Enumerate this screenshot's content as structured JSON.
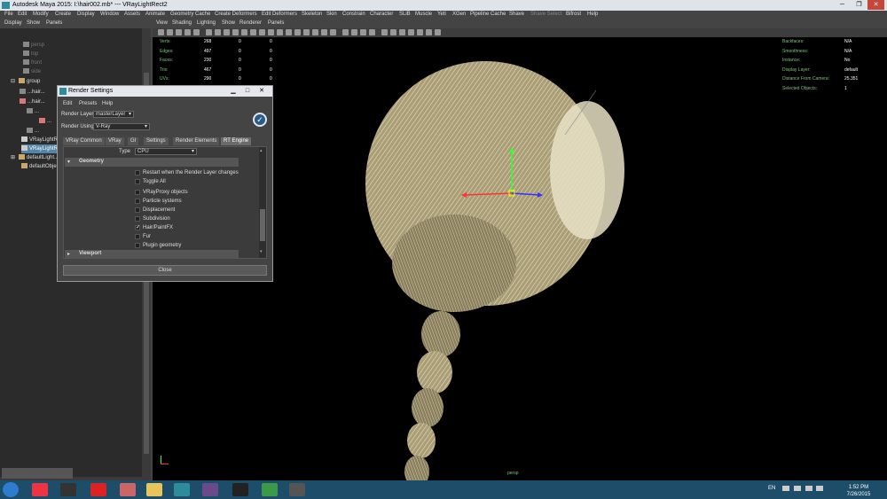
{
  "window": {
    "title": "Autodesk Maya 2015: I:\\hair002.mb*  ---  VRayLightRect2"
  },
  "menubar": [
    "File",
    "Edit",
    "Modify",
    "Create",
    "Display",
    "Window",
    "Assets",
    "Animate",
    "Geometry Cache",
    "Create Deformers",
    "Edit Deformers",
    "Skeleton",
    "Skin",
    "Constrain",
    "Character",
    "SLiB",
    "Muscle",
    "Yeti",
    "XGen",
    "Pipeline Cache",
    "Shave",
    "Shave Select",
    "Bifrost",
    "Help"
  ],
  "outliner": {
    "menu": [
      "Display",
      "Show",
      "Panels"
    ],
    "items": [
      "persp",
      "top",
      "front",
      "side",
      "group",
      "...hair...",
      "...hair...",
      "...",
      "...",
      "...",
      "VRayLightR...",
      "VRayLightR...",
      "defaultLight...",
      "defaultObje..."
    ]
  },
  "viewport": {
    "menu": [
      "View",
      "Shading",
      "Lighting",
      "Show",
      "Renderer",
      "Panels"
    ],
    "hud_left": {
      "labels": [
        "Verts:",
        "Edges:",
        "Faces:",
        "Tris:",
        "UVs:"
      ],
      "col1": [
        "268",
        "497",
        "230",
        "467",
        "290"
      ],
      "col2": [
        "0",
        "0",
        "0",
        "0",
        "0"
      ],
      "col3": [
        "0",
        "0",
        "0",
        "0",
        "0"
      ]
    },
    "hud_right": {
      "labels": [
        "Backfaces:",
        "Smoothness:",
        "Instance:",
        "Display Layer:",
        "Distance From Camera:",
        "Selected Objects:"
      ],
      "values": [
        "N/A",
        "N/A",
        "No",
        "default",
        "25.351",
        "1"
      ]
    },
    "camera": "persp"
  },
  "dialog": {
    "title": "Render Settings",
    "menu": [
      "Edit",
      "Presets",
      "Help"
    ],
    "render_layer_label": "Render Layer",
    "render_layer_value": "masterLayer",
    "render_using_label": "Render Using",
    "render_using_value": "V-Ray",
    "tabs": [
      "VRay Common",
      "VRay",
      "GI",
      "Settings",
      "Render Elements",
      "RT Engine"
    ],
    "active_tab": "RT Engine",
    "type_label": "Type",
    "type_value": "CPU",
    "geometry_section": "Geometry",
    "options": [
      {
        "label": "Restart when the Render Layer changes",
        "checked": false
      },
      {
        "label": "Toggle All",
        "checked": false
      },
      {
        "label": "VRayProxy objects",
        "checked": false
      },
      {
        "label": "Particle systems",
        "checked": false
      },
      {
        "label": "Displacement",
        "checked": false
      },
      {
        "label": "Subdivision",
        "checked": false
      },
      {
        "label": "Hair/PaintFX",
        "checked": true
      },
      {
        "label": "Fur",
        "checked": false
      },
      {
        "label": "Plugin geometry",
        "checked": false
      }
    ],
    "viewport_section": "Viewport",
    "close_label": "Close"
  },
  "taskbar": {
    "lang": "EN",
    "time": "1:52 PM",
    "date": "7/26/2015"
  },
  "colors": {
    "accent": "#5285a6",
    "hud_green": "#7ec47e",
    "hair": "#c8bf9a"
  }
}
